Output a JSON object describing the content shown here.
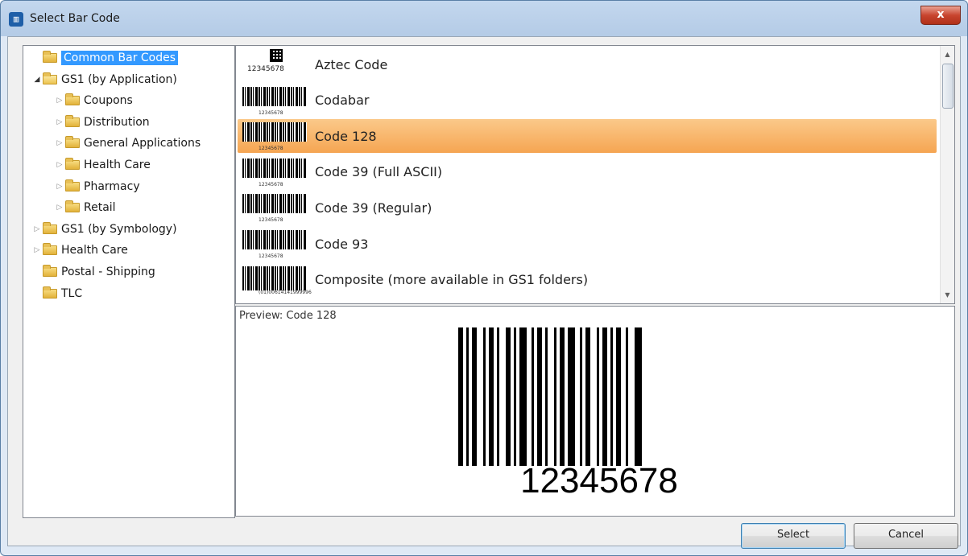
{
  "window": {
    "title": "Select Bar Code",
    "close_label": "x"
  },
  "tree": {
    "items": [
      {
        "label": "Common Bar Codes",
        "level": 0,
        "expander": "none",
        "selected": true
      },
      {
        "label": "GS1 (by Application)",
        "level": 0,
        "expander": "expanded",
        "selected": false
      },
      {
        "label": "Coupons",
        "level": 1,
        "expander": "collapsed",
        "selected": false
      },
      {
        "label": "Distribution",
        "level": 1,
        "expander": "collapsed",
        "selected": false
      },
      {
        "label": "General Applications",
        "level": 1,
        "expander": "collapsed",
        "selected": false
      },
      {
        "label": "Health Care",
        "level": 1,
        "expander": "collapsed",
        "selected": false
      },
      {
        "label": "Pharmacy",
        "level": 1,
        "expander": "collapsed",
        "selected": false
      },
      {
        "label": "Retail",
        "level": 1,
        "expander": "collapsed",
        "selected": false
      },
      {
        "label": "GS1 (by Symbology)",
        "level": 0,
        "expander": "collapsed",
        "selected": false
      },
      {
        "label": "Health Care",
        "level": 0,
        "expander": "collapsed",
        "selected": false
      },
      {
        "label": "Postal - Shipping",
        "level": 0,
        "expander": "none",
        "selected": false
      },
      {
        "label": "TLC",
        "level": 0,
        "expander": "none",
        "selected": false
      }
    ]
  },
  "barcode_list": {
    "items": [
      {
        "label": "Aztec Code",
        "thumb_type": "aztec",
        "thumb_number": "12345678",
        "selected": false
      },
      {
        "label": "Codabar",
        "thumb_type": "linear",
        "thumb_number": "12345678",
        "selected": false
      },
      {
        "label": "Code 128",
        "thumb_type": "linear",
        "thumb_number": "12345678",
        "selected": true
      },
      {
        "label": "Code 39 (Full ASCII)",
        "thumb_type": "linear",
        "thumb_number": "12345678",
        "selected": false
      },
      {
        "label": "Code 39 (Regular)",
        "thumb_type": "linear",
        "thumb_number": "12345678",
        "selected": false
      },
      {
        "label": "Code 93",
        "thumb_type": "linear",
        "thumb_number": "12345678",
        "selected": false
      },
      {
        "label": "Composite (more available in GS1 folders)",
        "thumb_type": "composite",
        "thumb_number": "(01)00614141999996",
        "selected": false
      }
    ]
  },
  "preview": {
    "caption": "Preview: Code 128",
    "number": "12345678"
  },
  "buttons": {
    "select_label": "Select",
    "cancel_label": "Cancel"
  }
}
